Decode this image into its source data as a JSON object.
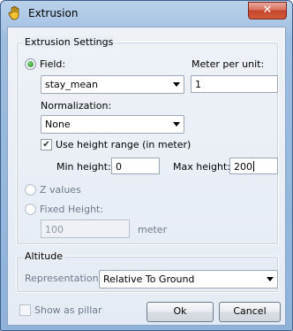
{
  "window": {
    "title": "Extrusion",
    "close_glyph": "✕"
  },
  "extrusion_settings": {
    "title": "Extrusion Settings",
    "field_label": "Field:",
    "field_selected": true,
    "field_value": "stay_mean",
    "meter_per_unit_label": "Meter per unit:",
    "meter_per_unit_value": "1",
    "normalization_label": "Normalization:",
    "normalization_value": "None",
    "use_height_range_label": "Use height range (in meter)",
    "use_height_range_checked": true,
    "check_glyph": "✔",
    "min_height_label": "Min height:",
    "min_height_value": "0",
    "max_height_label": "Max height:",
    "max_height_value": "200",
    "z_values_label": "Z values",
    "fixed_height_label": "Fixed Height:",
    "fixed_height_value": "100",
    "fixed_height_unit": "meter"
  },
  "altitude": {
    "title": "Altitude",
    "representation_label": "Representation",
    "representation_value": "Relative To Ground"
  },
  "footer": {
    "show_as_pillar_label": "Show as pillar",
    "show_as_pillar_checked": false,
    "ok_label": "Ok",
    "cancel_label": "Cancel"
  },
  "icons": {
    "title_icon": "hand-pointer-icon"
  }
}
